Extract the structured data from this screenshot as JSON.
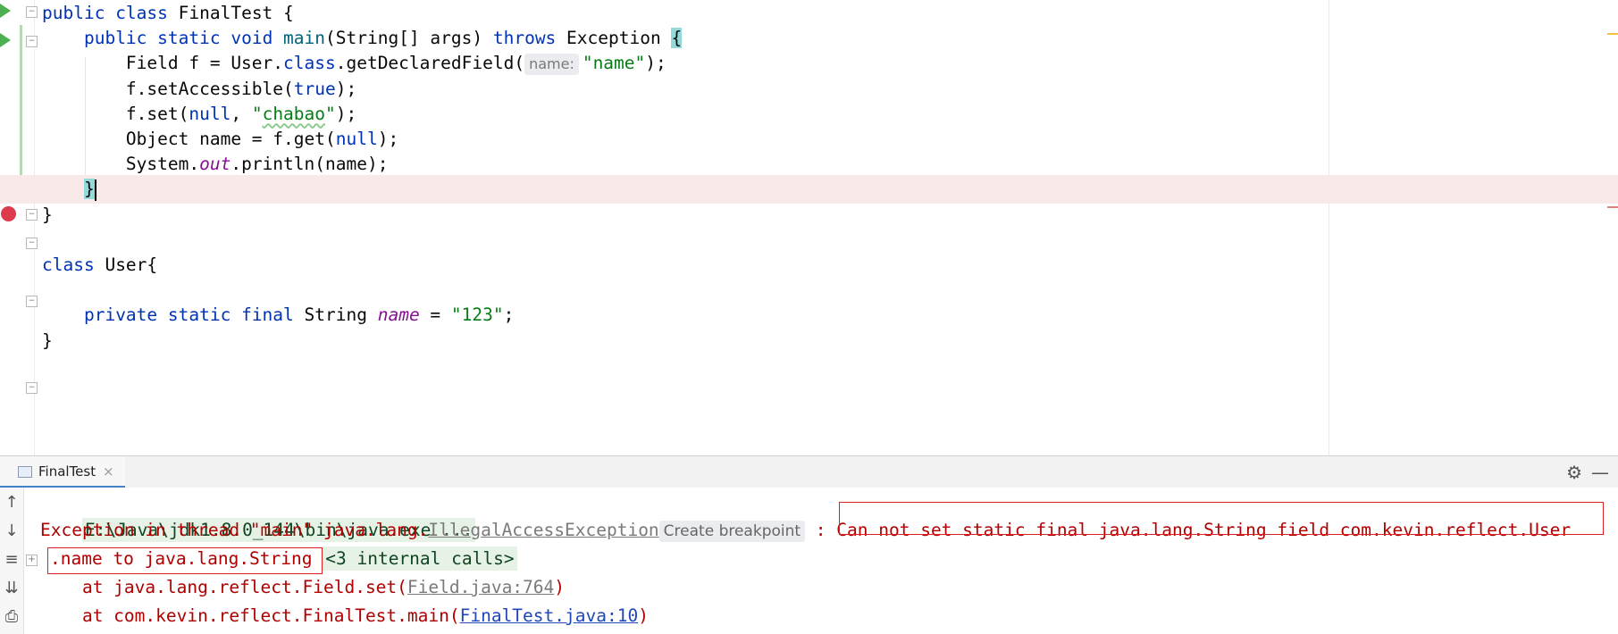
{
  "editor": {
    "lines": [
      {
        "tokens": [
          [
            "kw",
            "public "
          ],
          [
            "kw",
            "class "
          ],
          [
            "",
            "FinalTest {"
          ]
        ]
      },
      {
        "tokens": [
          [
            "",
            "    "
          ],
          [
            "kw",
            "public "
          ],
          [
            "kw",
            "static "
          ],
          [
            "kw",
            "void "
          ],
          [
            "fn",
            "main"
          ],
          [
            "",
            "(String[] args) "
          ],
          [
            "kw",
            "throws "
          ],
          [
            "",
            "Exception "
          ]
        ],
        "brace": "{"
      },
      {
        "tokens": [
          [
            "",
            "        Field f = User."
          ],
          [
            "kw",
            "class"
          ],
          [
            "",
            ".getDeclaredField("
          ]
        ],
        "hint": "name:",
        "after": [
          [
            "str",
            "\"name\""
          ],
          [
            "",
            ");"
          ]
        ]
      },
      {
        "tokens": [
          [
            "",
            "        f.setAccessible("
          ],
          [
            "kw",
            "true"
          ],
          [
            "",
            ");"
          ]
        ]
      },
      {
        "tokens": [
          [
            "",
            "        f.set("
          ],
          [
            "kw",
            "null"
          ],
          [
            "",
            ", "
          ],
          [
            "str",
            "\""
          ],
          [
            "typo",
            "chabao"
          ],
          [
            "str",
            "\""
          ],
          [
            "",
            ");"
          ]
        ]
      },
      {
        "tokens": [
          [
            "",
            "        Object name = f.get("
          ],
          [
            "kw",
            "null"
          ],
          [
            "",
            ");"
          ]
        ]
      },
      {
        "tokens": [
          [
            "",
            "        System."
          ],
          [
            "st",
            "out"
          ],
          [
            "",
            ".println(name);"
          ]
        ]
      },
      {
        "tokens": [
          [
            "",
            "    "
          ]
        ],
        "brace": "}",
        "caret": true
      },
      {
        "tokens": [
          [
            "",
            "}"
          ]
        ]
      },
      {
        "tokens": [
          [
            "",
            ""
          ]
        ]
      },
      {
        "tokens": [
          [
            "kw",
            "class "
          ],
          [
            "",
            "User{"
          ]
        ]
      },
      {
        "tokens": [
          [
            "",
            ""
          ]
        ]
      },
      {
        "tokens": [
          [
            "",
            "    "
          ],
          [
            "kw",
            "private "
          ],
          [
            "kw",
            "static "
          ],
          [
            "kw",
            "final "
          ],
          [
            "",
            "String "
          ],
          [
            "st",
            "name"
          ],
          [
            "",
            " = "
          ],
          [
            "str",
            "\"123\""
          ],
          [
            "",
            ";"
          ]
        ]
      },
      {
        "tokens": [
          [
            "",
            "}"
          ]
        ]
      }
    ]
  },
  "console": {
    "tab_label": "FinalTest",
    "tab_close": "×",
    "settings_icon": "gear-icon",
    "minimize_icon": "minimize-icon",
    "command": "E:\\Java\\jdk1.8.0_144\\bin\\java.exe ...",
    "exception_prefix": "Exception in thread \"main\" java.lang.",
    "exception_class": "IllegalAccessException",
    "create_breakpoint": "Create breakpoint",
    "colon": " : ",
    "message_part1": "Can not set static final java.lang.String field com.kevin.reflect.User",
    "message_part2": ".name to java.lang.String",
    "internal_calls": "<3 internal calls>",
    "trace1_prefix": "    at java.lang.reflect.Field.set(",
    "trace1_link": "Field.java:764",
    "trace1_suffix": ")",
    "trace2_prefix": "    at com.kevin.reflect.FinalTest.main(",
    "trace2_link": "FinalTest.java:10",
    "trace2_suffix": ")"
  },
  "colors": {
    "keyword": "#0033b3",
    "string": "#067d17",
    "static_field": "#871094",
    "error_text": "#b00000",
    "highlight_line": "#fae9e9",
    "breakpoint": "#db3b4b"
  }
}
